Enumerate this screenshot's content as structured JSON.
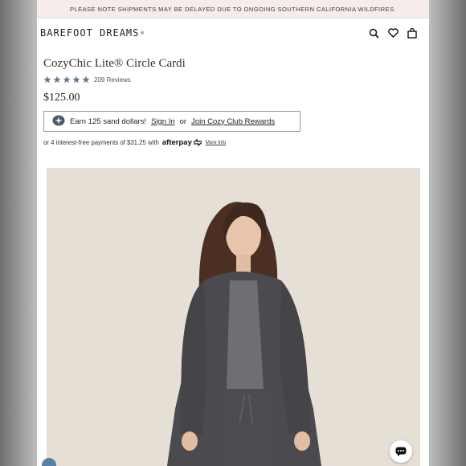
{
  "banner": {
    "text": "PLEASE NOTE SHIPMENTS MAY BE DELAYED DUE TO ONGOING SOUTHERN CALIFORNIA WILDFIRES."
  },
  "header": {
    "logo": "BAREFOOT DREAMS",
    "logo_tm": "®",
    "icons": [
      "search-icon",
      "heart-icon",
      "bag-icon"
    ]
  },
  "product": {
    "title": "CozyChic Lite® Circle Cardi",
    "rating": 5,
    "reviews_label": "209 Reviews",
    "price": "$125.00"
  },
  "rewards": {
    "text_prefix": "Earn 125 sand dollars!",
    "sign_in": "Sign In",
    "or": "or",
    "join": "Join Cozy Club Rewards"
  },
  "afterpay": {
    "text": "or 4 interest-free payments of $31.25 with",
    "brand": "afterpay",
    "more_info": "More Info"
  },
  "colors": {
    "star": "#5f7790",
    "banner_bg": "#f7ecec",
    "cardigan": "#4a4a4f",
    "top": "#6e6e73",
    "backdrop": "#e5dfd6"
  }
}
